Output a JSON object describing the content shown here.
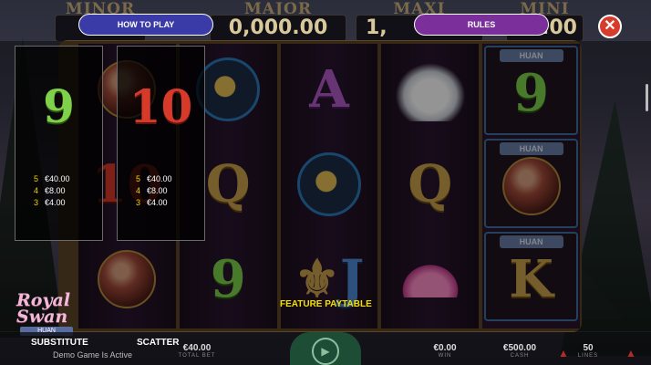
{
  "header": {
    "how_to_play_label": "HOW TO PLAY",
    "rules_label": "RULES",
    "close_symbol": "✕"
  },
  "jackpots": [
    {
      "name": "MINOR",
      "value": ""
    },
    {
      "name": "MAJOR",
      "value": "0,000.00"
    },
    {
      "name": "MAXI",
      "value": "1,"
    },
    {
      "name": "MINI",
      "value": ".00"
    }
  ],
  "reels": {
    "wild_tag": "HUAN"
  },
  "paytable": {
    "cards": [
      {
        "symbol": "9",
        "color": "#7fd04a",
        "pays": [
          {
            "count": "5",
            "amount": "€40.00"
          },
          {
            "count": "4",
            "amount": "€8.00"
          },
          {
            "count": "3",
            "amount": "€4.00"
          }
        ]
      },
      {
        "symbol": "10",
        "color": "#d83a2a",
        "pays": [
          {
            "count": "5",
            "amount": "€40.00"
          },
          {
            "count": "4",
            "amount": "€8.00"
          },
          {
            "count": "3",
            "amount": "€4.00"
          }
        ]
      }
    ],
    "feature_title": "FEATURE PAYTABLE",
    "tabs": [
      "SUBSTITUTE",
      "SCATTER"
    ]
  },
  "logo": {
    "text_line1": "Royal",
    "text_line2": "Swan",
    "tag": "HUAN"
  },
  "status": {
    "demo_text": "Demo Game Is Active",
    "total_bet": {
      "value": "€40.00",
      "label": "TOTAL BET"
    },
    "win": {
      "value": "€0.00",
      "label": "WIN"
    },
    "cash": {
      "value": "€500.00",
      "label": "CASH"
    },
    "lines": {
      "value": "50",
      "label": "LINES"
    }
  }
}
